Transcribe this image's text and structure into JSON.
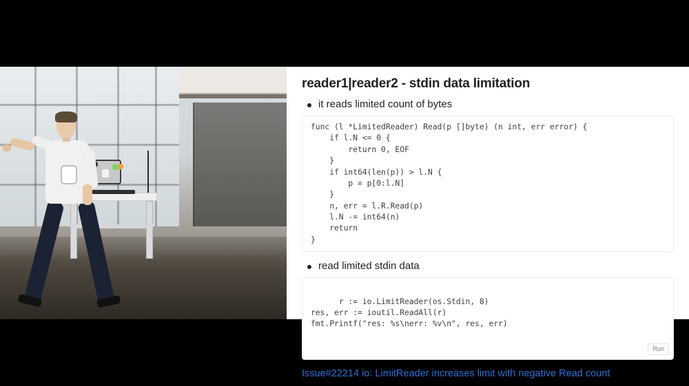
{
  "slide": {
    "title": "reader1|reader2 - stdin data limitation",
    "bullet1": "it reads limited count of bytes",
    "code1": "func (l *LimitedReader) Read(p []byte) (n int, err error) {\n    if l.N <= 0 {\n        return 0, EOF\n    }\n    if int64(len(p)) > l.N {\n        p = p[0:l.N]\n    }\n    n, err = l.R.Read(p)\n    l.N -= int64(n)\n    return\n}",
    "bullet2": "read limited stdin data",
    "code2": "r := io.LimitReader(os.Stdin, 8)\nres, err := ioutil.ReadAll(r)\nfmt.Printf(\"res: %s\\nerr: %v\\n\", res, err)",
    "run_label": "Run",
    "issue_link": "Issue#22214 io: LimitReader increases limit with negative Read count"
  }
}
